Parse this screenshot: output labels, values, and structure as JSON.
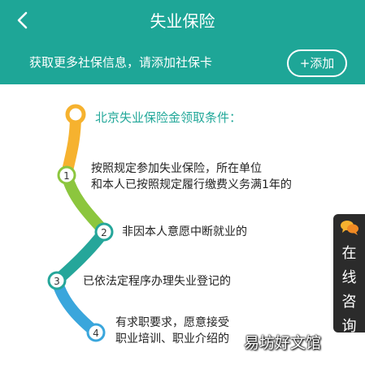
{
  "header": {
    "title": "失业保险"
  },
  "banner": {
    "text": "获取更多社保信息，请添加社保卡",
    "add_label": "+添加"
  },
  "conditions": {
    "heading": "北京失业保险金领取条件：",
    "steps": [
      {
        "num": "1",
        "line1": "按照规定参加失业保险，所在单位",
        "line2": "和本人已按照规定履行缴费义务满1年的"
      },
      {
        "num": "2",
        "line1": "非因本人意愿中断就业的"
      },
      {
        "num": "3",
        "line1": "已依法定程序办理失业登记的"
      },
      {
        "num": "4",
        "line1": "有求职要求，愿意接受",
        "line2": "职业培训、职业介绍的"
      }
    ]
  },
  "chat": {
    "label_1": "在",
    "label_2": "线",
    "label_3": "咨",
    "label_4": "询"
  },
  "watermark": "易坊好文馆",
  "colors": {
    "teal": "#1ea697",
    "orange": "#f6b22f",
    "green": "#8cc63e",
    "teal_road": "#25a69a",
    "blue": "#3aa6dc"
  },
  "icons": {
    "back": "chevron-left-icon",
    "chat": "chat-bubbles-icon"
  }
}
